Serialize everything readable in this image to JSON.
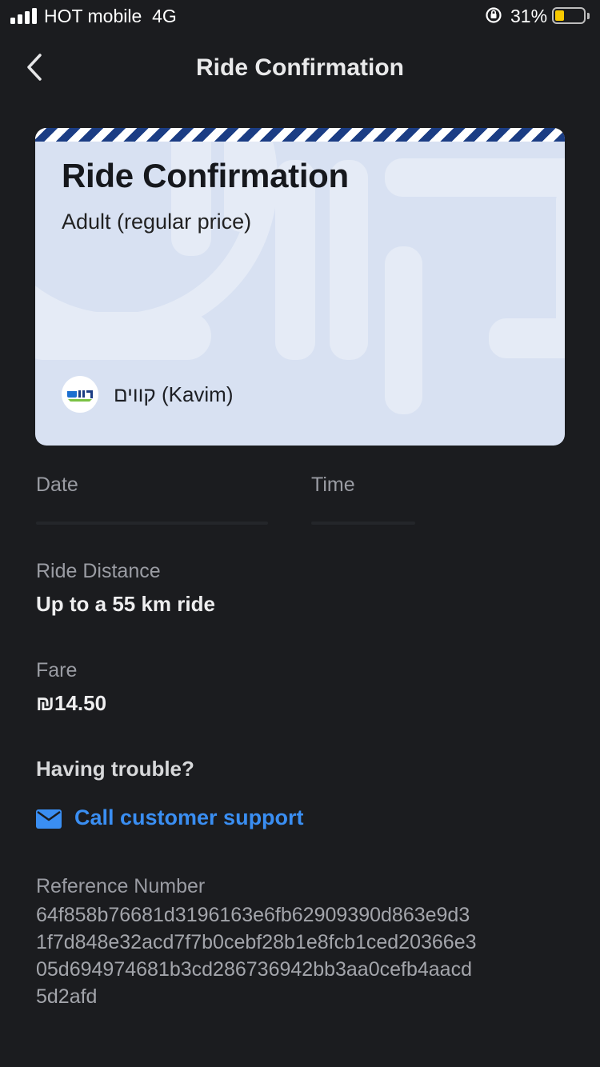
{
  "status_bar": {
    "carrier": "HOT mobile",
    "network": "4G",
    "battery_percent": "31%",
    "battery_level": 0.31,
    "battery_color": "#f7c900"
  },
  "nav": {
    "title": "Ride Confirmation",
    "back_icon": "chevron-left-icon"
  },
  "ticket": {
    "title": "Ride Confirmation",
    "subtitle": "Adult (regular price)",
    "operator": "קווים (Kavim)",
    "stripe_color": "#1b3d84",
    "card_color": "#d8e1f2"
  },
  "details": {
    "date_label": "Date",
    "time_label": "Time",
    "distance_label": "Ride Distance",
    "distance_value": "Up to a 55 km ride",
    "fare_label": "Fare",
    "fare_value": "₪14.50"
  },
  "support": {
    "heading": "Having trouble?",
    "link": "Call customer support",
    "icon": "mail-icon",
    "link_color": "#3a8ef2"
  },
  "reference": {
    "label": "Reference Number",
    "lines": [
      "64f858b76681d3196163e6fb62909390d863e9d3",
      "1f7d848e32acd7f7b0cebf28b1e8fcb1ced20366e3",
      "05d694974681b3cd286736942bb3aa0cefb4aacd",
      "5d2afd"
    ]
  }
}
